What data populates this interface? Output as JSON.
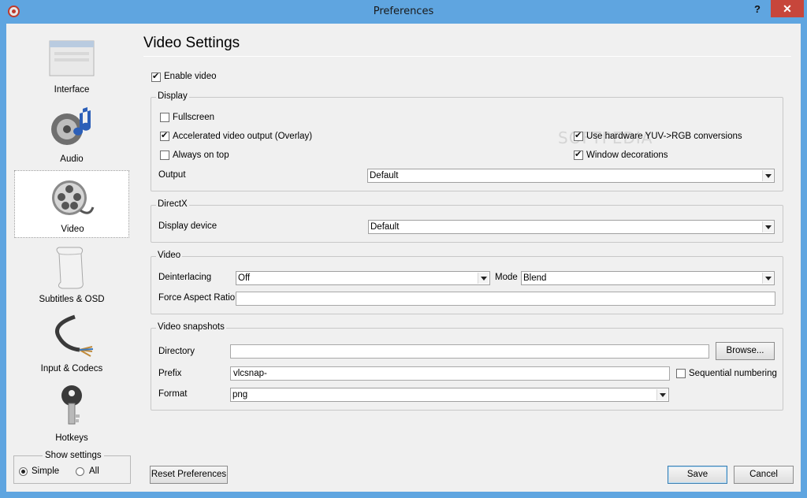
{
  "window": {
    "title": "Preferences",
    "help": "?",
    "close": "✕"
  },
  "sidebar": {
    "items": [
      {
        "label": "Interface",
        "icon": "interface-window-icon"
      },
      {
        "label": "Audio",
        "icon": "audio-speaker-icon"
      },
      {
        "label": "Video",
        "icon": "film-reel-icon"
      },
      {
        "label": "Subtitles & OSD",
        "icon": "scroll-icon"
      },
      {
        "label": "Input & Codecs",
        "icon": "cable-icon"
      },
      {
        "label": "Hotkeys",
        "icon": "key-icon"
      }
    ],
    "active": "Video",
    "show_settings": {
      "legend": "Show settings",
      "simple": "Simple",
      "all": "All",
      "selected": "Simple"
    }
  },
  "main": {
    "title": "Video Settings",
    "enable_video": {
      "label": "Enable video",
      "checked": true
    },
    "display": {
      "legend": "Display",
      "fullscreen": {
        "label": "Fullscreen",
        "checked": false
      },
      "accelerated": {
        "label": "Accelerated video output (Overlay)",
        "checked": true
      },
      "always_on_top": {
        "label": "Always on top",
        "checked": false
      },
      "hw_yuv": {
        "label": "Use hardware YUV->RGB conversions",
        "checked": true
      },
      "window_decorations": {
        "label": "Window decorations",
        "checked": true
      },
      "output_label": "Output",
      "output_value": "Default"
    },
    "directx": {
      "legend": "DirectX",
      "device_label": "Display device",
      "device_value": "Default"
    },
    "video": {
      "legend": "Video",
      "deinterlacing_label": "Deinterlacing",
      "deinterlacing_value": "Off",
      "mode_label": "Mode",
      "mode_value": "Blend",
      "aspect_label": "Force Aspect Ratio",
      "aspect_value": ""
    },
    "snapshots": {
      "legend": "Video snapshots",
      "directory_label": "Directory",
      "directory_value": "",
      "browse": "Browse...",
      "prefix_label": "Prefix",
      "prefix_value": "vlcsnap-",
      "sequential": {
        "label": "Sequential numbering",
        "checked": false
      },
      "format_label": "Format",
      "format_value": "png"
    }
  },
  "footer": {
    "reset": "Reset Preferences",
    "save": "Save",
    "cancel": "Cancel"
  },
  "watermark": "SOFTPEDIA",
  "colors": {
    "titlebar": "#5fa5e0",
    "close": "#c7463b",
    "client": "#f0f0f0"
  }
}
